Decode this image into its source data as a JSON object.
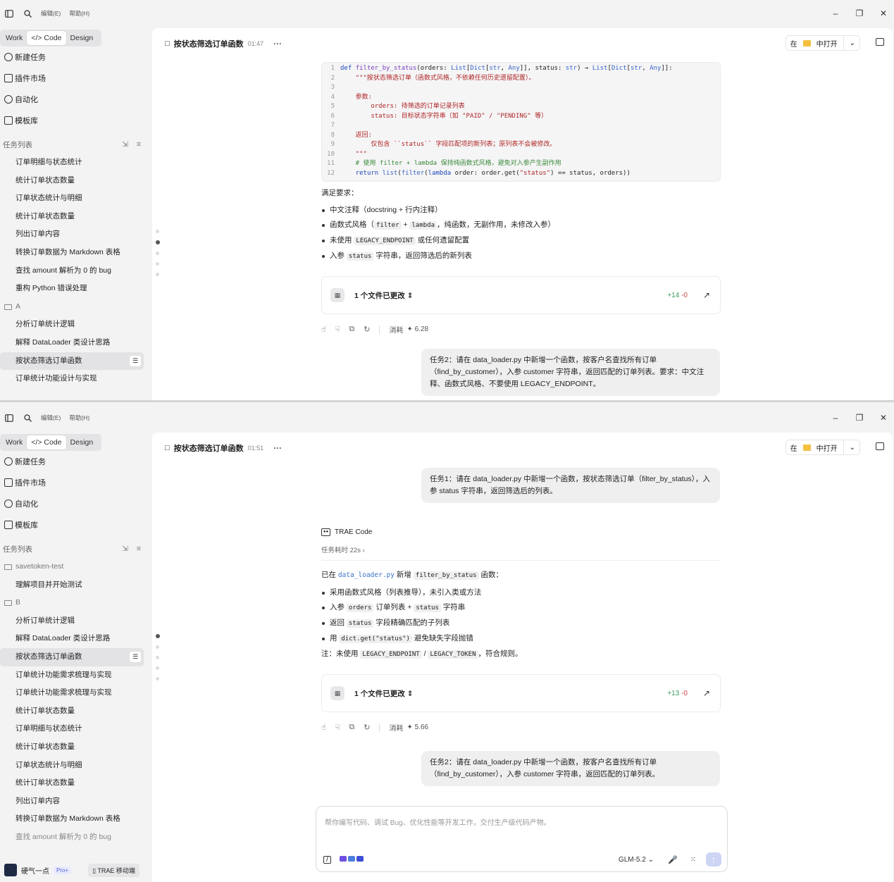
{
  "top": {
    "menu": {
      "edit": "编辑(E)",
      "help": "帮助(H)"
    },
    "modes": [
      "Work",
      "Code",
      "Design"
    ],
    "nav": [
      "新建任务",
      "插件市场",
      "自动化",
      "模板库"
    ],
    "task_list_title": "任务列表",
    "tasks_a": [
      "订单明细与状态统计",
      "统计订单状态数量",
      "订单状态统计与明细",
      "统计订单状态数量",
      "列出订单内容",
      "转换订单数据为 Markdown 表格",
      "查找 amount 解析为 0 的 bug",
      "重构 Python 错误处理"
    ],
    "folder": "A",
    "tasks_b": [
      "分析订单统计逻辑",
      "解释 DataLoader 类设计思路",
      "按状态筛选订单函数",
      "订单统计功能设计与实现"
    ],
    "chat_title": "按状态筛选订单函数",
    "chat_time": "01:47",
    "open_in": "在",
    "open_label": "中打开",
    "code_lines": [
      {
        "n": "1"
      },
      {
        "n": "2"
      },
      {
        "n": "3"
      },
      {
        "n": "4"
      },
      {
        "n": "5"
      },
      {
        "n": "6"
      },
      {
        "n": "7"
      },
      {
        "n": "8"
      },
      {
        "n": "9"
      },
      {
        "n": "10"
      },
      {
        "n": "11"
      },
      {
        "n": "12"
      }
    ],
    "requirements_title": "满足要求：",
    "req1": "中文注释（docstring + 行内注释）",
    "req2_pre": "函数式风格（",
    "req2_c1": "filter",
    "req2_mid": " + ",
    "req2_c2": "lambda",
    "req2_post": "，纯函数，无副作用，未修改入参）",
    "req3_pre": "未使用 ",
    "req3_c": "LEGACY_ENDPOINT",
    "req3_post": " 或任何遗留配置",
    "req4_pre": "入参 ",
    "req4_c": "status",
    "req4_post": " 字符串，返回筛选后的新列表",
    "files_changed": "1 个文件已更改",
    "diff_add": "+14",
    "diff_del": "-0",
    "cost_label": "消耗",
    "cost_value": "6.28",
    "task2_msg": "任务2：请在 data_loader.py 中新增一个函数，按客户名查找所有订单（find_by_customer），入参 customer 字符串，返回匹配的订单列表。要求：中文注释、函数式风格、不要使用 LEGACY_ENDPOINT。"
  },
  "bottom": {
    "menu": {
      "edit": "编辑(E)",
      "help": "帮助(H)"
    },
    "modes": [
      "Work",
      "Code",
      "Design"
    ],
    "nav": [
      "新建任务",
      "插件市场",
      "自动化",
      "模板库"
    ],
    "task_list_title": "任务列表",
    "folder1": "savetoken-test",
    "tasks_1": [
      "理解项目并开始测试"
    ],
    "folder2": "B",
    "tasks_2": [
      "分析订单统计逻辑",
      "解释 DataLoader 类设计思路",
      "按状态筛选订单函数",
      "订单统计功能需求梳理与实现",
      "订单统计功能需求梳理与实现",
      "统计订单状态数量",
      "订单明细与状态统计",
      "统计订单状态数量",
      "订单状态统计与明细",
      "统计订单状态数量",
      "列出订单内容",
      "转换订单数据为 Markdown 表格",
      "查找 amount 解析为 0 的 bug"
    ],
    "chat_title": "按状态筛选订单函数",
    "chat_time": "01:51",
    "open_in": "在",
    "open_label": "中打开",
    "task1_msg": "任务1：请在 data_loader.py 中新增一个函数，按状态筛选订单（filter_by_status），入参 status 字符串，返回筛选后的列表。",
    "agent_name": "TRAE Code",
    "took": "任务耗时 22s",
    "sum_pre": "已在 ",
    "sum_file": "data_loader.py",
    "sum_mid": " 新增 ",
    "sum_fn": "filter_by_status",
    "sum_post": " 函数：",
    "b1": "采用函数式风格（列表推导），未引入类或方法",
    "b2_pre": "入参 ",
    "b2_c1": "orders",
    "b2_mid": " 订单列表 + ",
    "b2_c2": "status",
    "b2_post": " 字符串",
    "b3_pre": "返回 ",
    "b3_c": "status",
    "b3_post": " 字段精确匹配的子列表",
    "b4_pre": "用 ",
    "b4_c": "dict.get(\"status\")",
    "b4_post": " 避免缺失字段抛错",
    "note_pre": "注：未使用 ",
    "note_c1": "LEGACY_ENDPOINT",
    "note_mid": " / ",
    "note_c2": "LEGACY_TOKEN",
    "note_post": "，符合规则。",
    "files_changed": "1 个文件已更改",
    "diff_add": "+13",
    "diff_del": "-0",
    "cost_label": "消耗",
    "cost_value": "5.66",
    "task2_msg": "任务2：请在 data_loader.py 中新增一个函数，按客户名查找所有订单（find_by_customer），入参 customer 字符串，返回匹配的订单列表。",
    "composer_placeholder": "帮你编写代码、调试 Bug、优化性能等开发工作，交付生产级代码产物。",
    "model": "GLM-5.2",
    "user_name": "硬气一点",
    "plan": "Pro+",
    "mobile": "TRAE 移动端"
  }
}
